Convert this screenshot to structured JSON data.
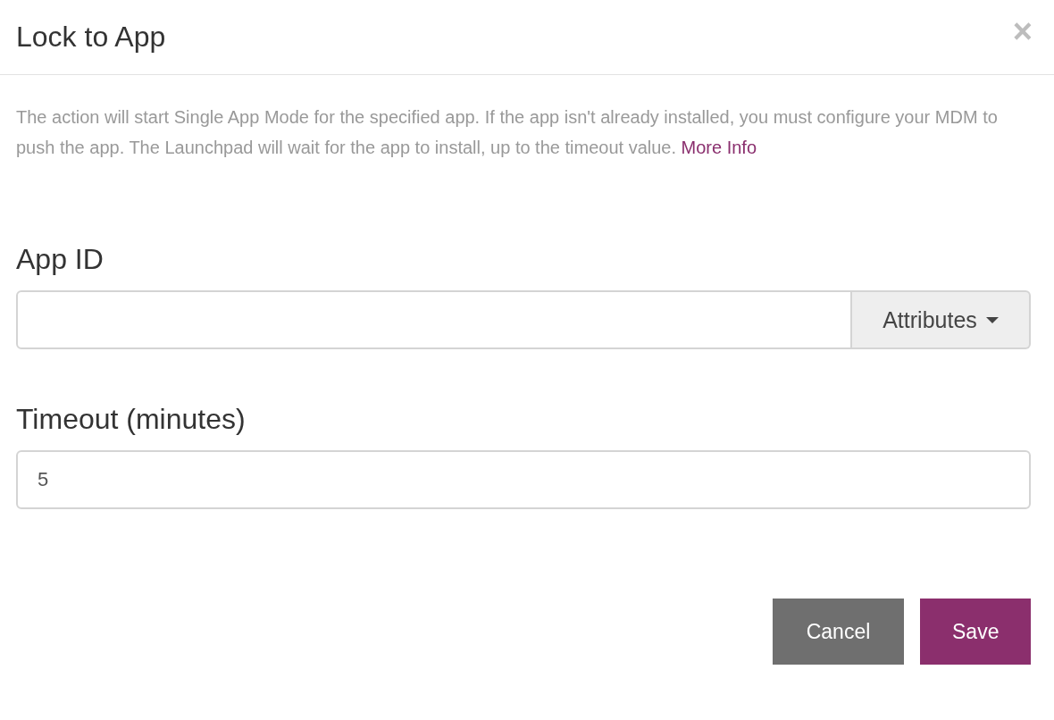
{
  "dialog": {
    "title": "Lock to App",
    "close": "×"
  },
  "description": {
    "text": "The action will start Single App Mode for the specified app. If the app isn't already installed, you must configure your MDM to push the app. The Launchpad will wait for the app to install, up to the timeout value.",
    "link": "More Info"
  },
  "fields": [
    {
      "kind": "addon",
      "label": "App ID",
      "addon": "Attributes"
    },
    {
      "kind": "plain",
      "label": "Timeout (minutes)",
      "value": "5"
    }
  ],
  "buttons": [
    {
      "kind": "secondary",
      "label": "Cancel"
    },
    {
      "kind": "primary",
      "label": "Save"
    }
  ]
}
